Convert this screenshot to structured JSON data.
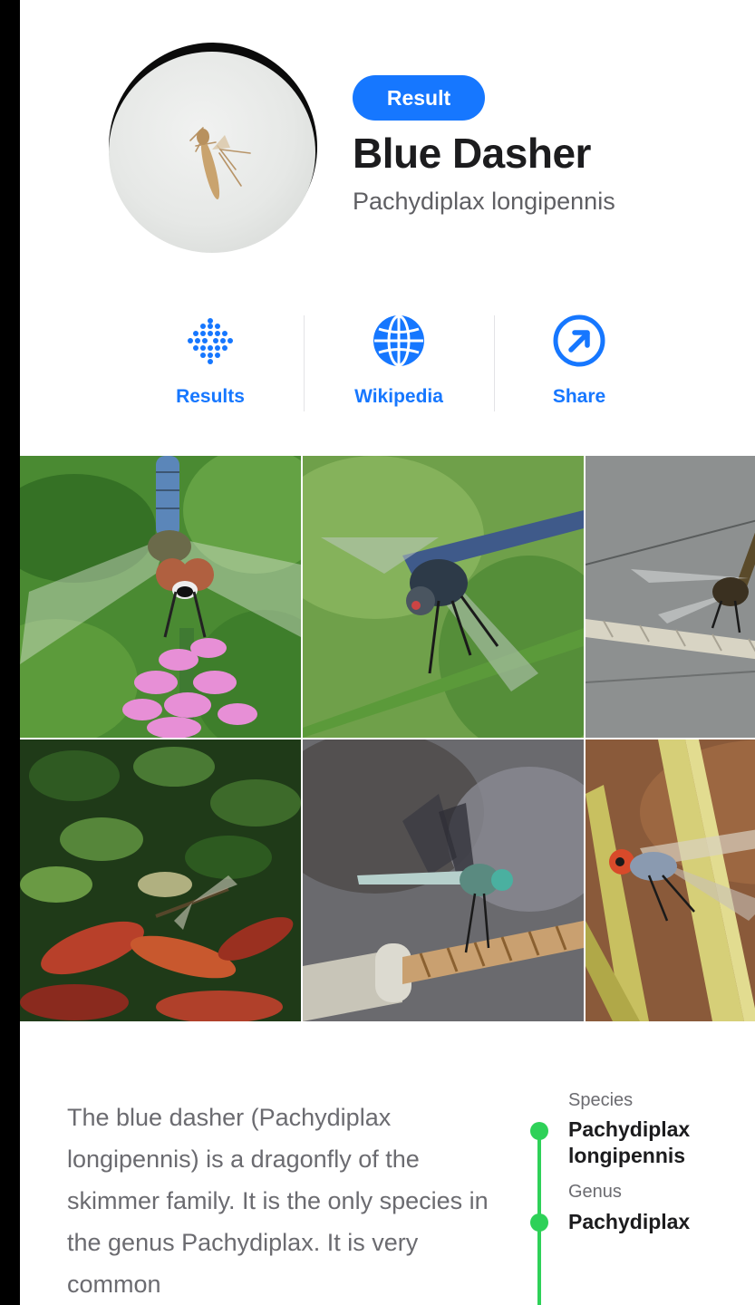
{
  "header": {
    "badge": "Result",
    "title": "Blue Dasher",
    "scientific_name": "Pachydiplax longipennis"
  },
  "actions": [
    {
      "label": "Results",
      "icon": "dots-grid-icon"
    },
    {
      "label": "Wikipedia",
      "icon": "globe-icon"
    },
    {
      "label": "Share",
      "icon": "share-arrow-icon"
    }
  ],
  "gallery": {
    "photos": [
      {
        "subject": "dragonfly-on-pink-flower"
      },
      {
        "subject": "dragonfly-on-grass-stem"
      },
      {
        "subject": "dragonfly-on-rope"
      },
      {
        "subject": "dragonfly-in-foliage"
      },
      {
        "subject": "dragonfly-on-twisted-rope"
      },
      {
        "subject": "dragonfly-on-straw"
      }
    ]
  },
  "description": "The blue dasher (Pachydiplax longipennis) is a dragonfly of the skimmer family. It is the only species in the genus Pachydiplax. It is very common",
  "taxonomy": [
    {
      "rank": "Species",
      "name": "Pachydiplax longipennis"
    },
    {
      "rank": "Genus",
      "name": "Pachydiplax"
    }
  ],
  "colors": {
    "accent": "#1677ff",
    "taxonomy_line": "#2ed158",
    "title": "#1c1c1e",
    "secondary_text": "#6b6b70"
  }
}
